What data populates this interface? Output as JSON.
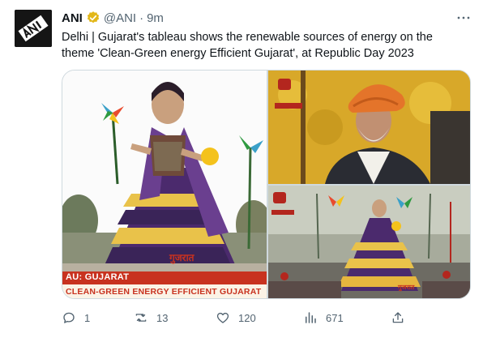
{
  "tweet": {
    "author_name": "ANI",
    "author_handle": "@ANI",
    "separator": "·",
    "timestamp": "9m",
    "text": "Delhi | Gujarat's tableau shows the renewable sources of energy on the theme 'Clean-Green energy Efficient Gujarat', at Republic Day 2023"
  },
  "media": {
    "main": {
      "caption_line1": "AU: GUJARAT",
      "caption_line2": "CLEAN-GREEN ENERGY EFFICIENT GUJARAT",
      "float_text": "गुजरात"
    },
    "bottom": {
      "float_text": "गुजरात"
    }
  },
  "actions": {
    "reply_count": "1",
    "retweet_count": "13",
    "like_count": "120",
    "view_count": "671"
  },
  "colors": {
    "text_primary": "#0f1419",
    "text_secondary": "#536471",
    "verified_badge": "#e2b719",
    "border": "#cfd9de",
    "caption_red": "#c8321f"
  },
  "icons": {
    "verified": "verified-badge-icon",
    "more": "more-icon",
    "reply": "reply-icon",
    "retweet": "retweet-icon",
    "like": "like-icon",
    "views": "views-icon",
    "share": "share-icon"
  }
}
